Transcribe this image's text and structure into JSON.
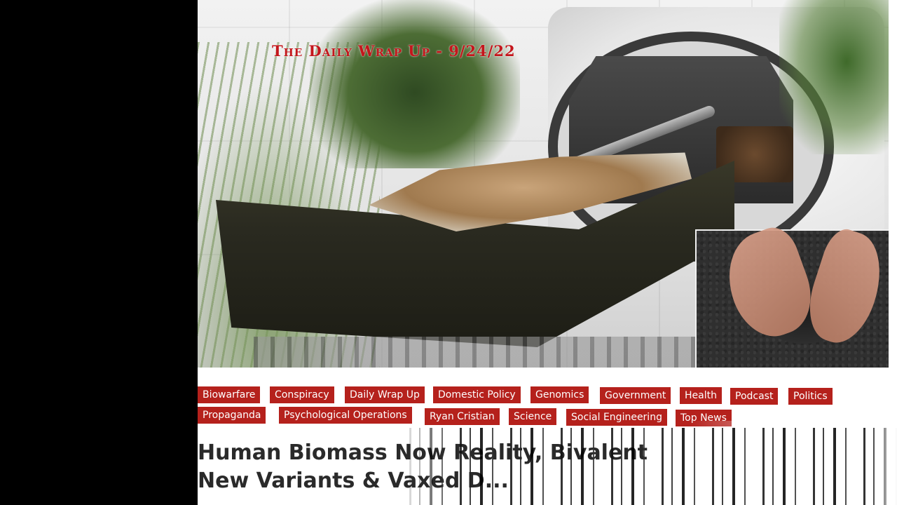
{
  "hero": {
    "title": "The Daily Wrap Up - 9/24/22"
  },
  "tags": [
    "Biowarfare",
    "Conspiracy",
    "Daily Wrap Up",
    "Domestic Policy",
    "Genomics",
    "Government",
    "Health",
    "Podcast",
    "Politics",
    "Propaganda",
    "Psychological Operations",
    "Ryan Cristian",
    "Science",
    "Social Engineering",
    "Top News"
  ],
  "article": {
    "headline_line1": "Human Biomass Now Reality, Bivalent",
    "headline_line2": "New Variants & Vaxed D..."
  },
  "colors": {
    "tag_background": "#b5211c",
    "title_red": "#c4161c",
    "headline_text": "#2a2a2a"
  }
}
